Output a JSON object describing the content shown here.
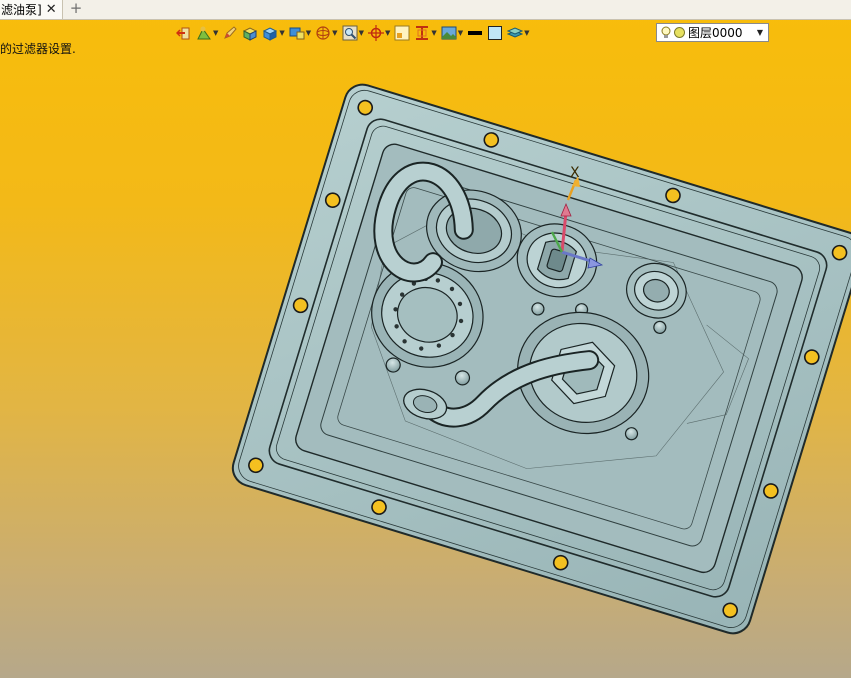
{
  "tab": {
    "label": "滤油泵]",
    "close": "✕",
    "add": "+"
  },
  "prompt": "的过滤器设置.",
  "toolbar": {
    "buttons": [
      {
        "name": "exit-icon",
        "dropdown": false
      },
      {
        "name": "filter-icon",
        "dropdown": true
      },
      {
        "name": "pencil-icon",
        "dropdown": false
      },
      {
        "name": "shaded-box-icon",
        "dropdown": false
      },
      {
        "name": "blue-box-icon",
        "dropdown": true
      },
      {
        "name": "display-icon",
        "dropdown": true
      },
      {
        "name": "sphere-icon",
        "dropdown": true
      },
      {
        "name": "zoom-box-icon",
        "dropdown": true
      },
      {
        "name": "target-icon",
        "dropdown": true
      },
      {
        "name": "layout-icon",
        "dropdown": false
      },
      {
        "name": "section-icon",
        "dropdown": true
      },
      {
        "name": "image-icon",
        "dropdown": true
      },
      {
        "name": "line-color-icon",
        "dropdown": false
      },
      {
        "name": "fill-color-icon",
        "dropdown": false
      },
      {
        "name": "layers-icon",
        "dropdown": true
      }
    ]
  },
  "layer": {
    "label": "图层0000",
    "arrow": "▼"
  },
  "axis": {
    "label": "X"
  },
  "colors": {
    "background_top": "#f8bd0a",
    "background_bottom": "#b6a88a",
    "part": "#a9c3c3",
    "axis_x": "#e8a020"
  }
}
